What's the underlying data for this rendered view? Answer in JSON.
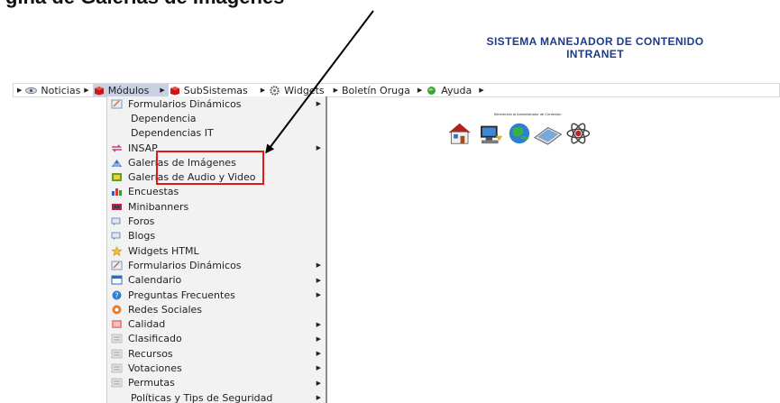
{
  "caption": "gina de Galerías de Imágenes",
  "header": {
    "title_line1": "SISTEMA MANEJADOR DE CONTENIDO",
    "title_line2": "INTRANET"
  },
  "menubar": [
    {
      "label": "Noticias",
      "icon": "eye-icon"
    },
    {
      "label": "Módulos",
      "icon": "red-cube-icon",
      "active": true
    },
    {
      "label": "SubSistemas",
      "icon": "red-cube-icon"
    },
    {
      "label": "Widgets",
      "icon": "gear-icon"
    },
    {
      "label": "Boletín Oruga",
      "icon": ""
    },
    {
      "label": "Ayuda",
      "icon": "green-globe-icon"
    }
  ],
  "submenu": [
    {
      "label": "Formularios Dinámicos",
      "icon": "form-icon",
      "arrow": true
    },
    {
      "label": "Dependencia",
      "icon": "",
      "arrow": false
    },
    {
      "label": "Dependencias IT",
      "icon": "",
      "arrow": false
    },
    {
      "label": "INSAP",
      "icon": "arrows-icon",
      "arrow": true
    },
    {
      "label": "Galerías de Imágenes",
      "icon": "gallery-icon",
      "arrow": false
    },
    {
      "label": "Galerías de Audio y Video",
      "icon": "film-icon",
      "arrow": false
    },
    {
      "label": "Encuestas",
      "icon": "chart-icon",
      "arrow": false
    },
    {
      "label": "Minibanners",
      "icon": "banner-icon",
      "arrow": false
    },
    {
      "label": "Foros",
      "icon": "forum-icon",
      "arrow": false
    },
    {
      "label": "Blogs",
      "icon": "blog-icon",
      "arrow": false
    },
    {
      "label": "Widgets HTML",
      "icon": "star-icon",
      "arrow": false
    },
    {
      "label": "Formularios Dinámicos",
      "icon": "form-icon",
      "arrow": true
    },
    {
      "label": "Calendario",
      "icon": "calendar-icon",
      "arrow": true
    },
    {
      "label": "Preguntas Frecuentes",
      "icon": "help-icon",
      "arrow": true
    },
    {
      "label": "Redes Sociales",
      "icon": "social-icon",
      "arrow": false
    },
    {
      "label": "Calidad",
      "icon": "quality-icon",
      "arrow": true
    },
    {
      "label": "Clasificado",
      "icon": "list-icon",
      "arrow": true
    },
    {
      "label": "Recursos",
      "icon": "list-icon",
      "arrow": true
    },
    {
      "label": "Votaciones",
      "icon": "list-icon",
      "arrow": true
    },
    {
      "label": "Permutas",
      "icon": "list-icon",
      "arrow": true
    },
    {
      "label": "Políticas y Tips de Seguridad",
      "icon": "",
      "arrow": true
    }
  ],
  "welcome_text": "Bienvenido al Administrador de Contenido",
  "home_icons": [
    "home-icon",
    "computer-icon",
    "globe-icon",
    "scanner-icon",
    "atom-icon"
  ],
  "colors": {
    "title": "#1f3a86",
    "menu_active": "#c9d2e3",
    "submenu_bg": "#f2f2f2",
    "highlight_box": "#e01818"
  }
}
